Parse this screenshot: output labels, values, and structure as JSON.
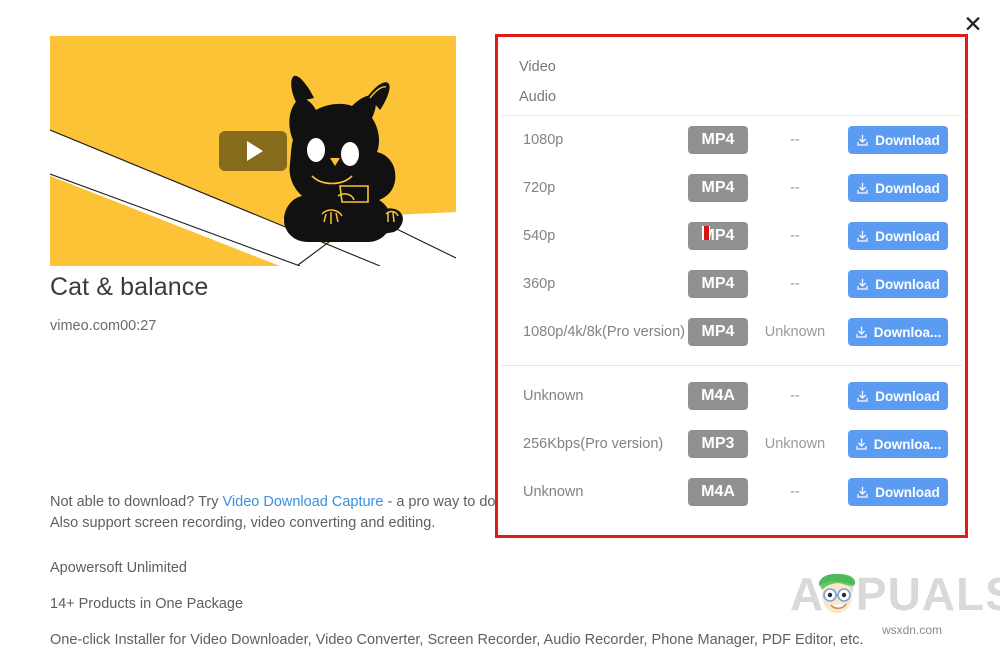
{
  "window": {
    "close_label": "✕"
  },
  "video": {
    "title": "Cat & balance",
    "source_and_duration": "vimeo.com00:27",
    "thumbnail_alt": "cat-balance-thumbnail",
    "play_button_label": "play"
  },
  "colors": {
    "panel_border": "#e21b15",
    "download_button": "#5b9cf2",
    "format_badge": "#919191",
    "thumbnail_background": "#fbc335",
    "link": "#3b8fe0"
  },
  "download_panel": {
    "tabs": [
      {
        "label": "Video"
      },
      {
        "label": "Audio"
      }
    ],
    "video_rows": [
      {
        "quality": "1080p",
        "format": "MP4",
        "size": "--",
        "action": "Download"
      },
      {
        "quality": "720p",
        "format": "MP4",
        "size": "--",
        "action": "Download"
      },
      {
        "quality": "540p",
        "format": "MP4",
        "size": "--",
        "action": "Download"
      },
      {
        "quality": "360p",
        "format": "MP4",
        "size": "--",
        "action": "Download"
      },
      {
        "quality": "1080p/4k/8k(Pro version)",
        "format": "MP4",
        "size": "Unknown",
        "action": "Downloa..."
      }
    ],
    "audio_rows": [
      {
        "quality": "Unknown",
        "format": "M4A",
        "size": "--",
        "action": "Download"
      },
      {
        "quality": "256Kbps(Pro version)",
        "format": "MP3",
        "size": "Unknown",
        "action": "Downloa..."
      },
      {
        "quality": "Unknown",
        "format": "M4A",
        "size": "--",
        "action": "Download"
      }
    ]
  },
  "promo": {
    "line1_prefix": "Not able to download? Try ",
    "line1_link": "Video Download Capture",
    "line1_suffix": " - a pro way to download live TV and RTMP/RTMPE stream from Hulu, CBS, NBC, etc.",
    "line2": "Also support screen recording, video converting and editing.",
    "item1": "Apowersoft Unlimited",
    "item2": "14+ Products in One Package",
    "item3": "One-click Installer for Video Downloader, Video Converter, Screen Recorder, Audio Recorder, Phone Manager, PDF Editor, etc."
  },
  "watermark": {
    "brand": "APPUALS",
    "site": "wsxdn.com"
  }
}
